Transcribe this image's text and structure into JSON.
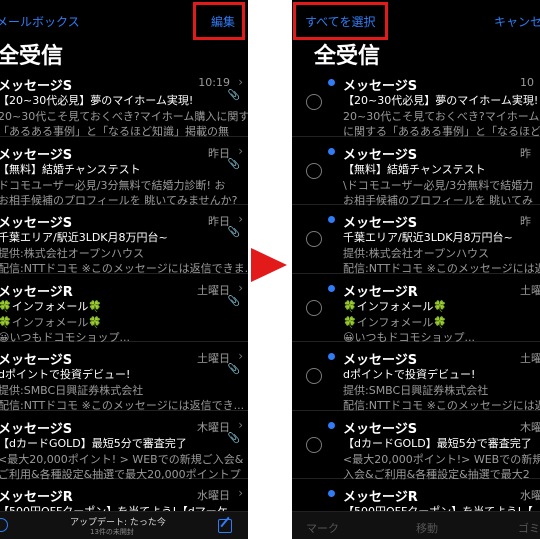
{
  "left": {
    "back_label": "メールボックス",
    "edit_label": "編集",
    "title": "全受信",
    "messages": [
      {
        "sender": "メッセージS",
        "date": "10:19",
        "subject": "【20~30代必見】夢のマイホーム実現!",
        "preview1": "20~30代こそ見ておくべき?マイホーム購入に関す",
        "preview2": "「あるある事例」と「なるほど知識」掲載の無"
      },
      {
        "sender": "メッセージS",
        "date": "昨日",
        "subject": "【無料】結婚チャンステスト",
        "preview1": "ドコモユーザー必見/3分無料で結婚力診断! お",
        "preview2": "お相手候補のプロフィールを 眺いてみませんか?"
      },
      {
        "sender": "メッセージS",
        "date": "昨日",
        "subject": "千葉エリア/駅近3LDK月8万円台~",
        "preview1": "提供:株式会社オープンハウス",
        "preview2": "配信:NTTドコモ ※このメッセージには返信できま..."
      },
      {
        "sender": "メッセージR",
        "date": "土曜日",
        "subject": "🍀インフォメール🍀",
        "preview1": "🍀インフォメール🍀",
        "preview2": "😀いつもドコモショップ..."
      },
      {
        "sender": "メッセージS",
        "date": "土曜日",
        "subject": "dポイントで投資デビュー!",
        "preview1": "提供:SMBC日興証券株式会社",
        "preview2": "配信:NTTドコモ ※このメッセージには返信でき..."
      },
      {
        "sender": "メッセージS",
        "date": "木曜日",
        "subject": "【dカードGOLD】最短5分で審査完了",
        "preview1": "<最大20,000ポイント! > WEBでの新規ご入会&",
        "preview2": "ご利用&各種設定&抽選で最大20,000ポイントプ"
      },
      {
        "sender": "メッセージR",
        "date": "水曜日",
        "subject": "【500円OFFクーポン】を当てよう!【dマーケ...",
        "preview1": "",
        "preview2": ""
      }
    ],
    "update_main": "アップデート: たった今",
    "update_sub": "13件の未開封"
  },
  "right": {
    "select_all_label": "すべてを選択",
    "cancel_label": "キャンセル",
    "title": "全受信",
    "messages": [
      {
        "sender": "メッセージS",
        "date": "10",
        "subject": "【20~30代必見】夢のマイホーム実現!",
        "preview1": "20~30代こそ見ておくべき?マイホーム購入に関",
        "preview2": "に関する「あるある事例」と「なるほど知識」"
      },
      {
        "sender": "メッセージS",
        "date": "昨",
        "subject": "【無料】結婚チャンステスト",
        "preview1": "\\ドコモユーザー必見/3分無料で結婚力",
        "preview2": "お相手候補のプロフィールを 眺いてみ"
      },
      {
        "sender": "メッセージS",
        "date": "昨",
        "subject": "千葉エリア/駅近3LDK月8万円台~",
        "preview1": "提供:株式会社オープンハウス",
        "preview2": "配信:NTTドコモ ※このメッセージには返信で"
      },
      {
        "sender": "メッセージR",
        "date": "土曜",
        "subject": "🍀インフォメール🍀",
        "preview1": "🍀インフォメール🍀",
        "preview2": "😀いつもドコモショップ..."
      },
      {
        "sender": "メッセージS",
        "date": "土曜",
        "subject": "dポイントで投資デビュー!",
        "preview1": "提供:SMBC日興証券株式会社",
        "preview2": "配信:NTTドコモ ※このメッセージには返信で"
      },
      {
        "sender": "メッセージS",
        "date": "木曜",
        "subject": "【dカードGOLD】最短5分で審査完了",
        "preview1": "<最大20,000ポイント!> WEBでの新規",
        "preview2": "入会&ご利用&各種設定&抽選で最大2"
      },
      {
        "sender": "メッセージR",
        "date": "水曜",
        "subject": "【500円OFFクーポン】を当てよう!【",
        "preview1": "",
        "preview2": ""
      }
    ],
    "bottom_actions": [
      "マーク",
      "移動",
      "ゴミ"
    ]
  },
  "colors": {
    "accent": "#2f7cf6",
    "highlight": "#e21a1a",
    "background": "#000000"
  }
}
